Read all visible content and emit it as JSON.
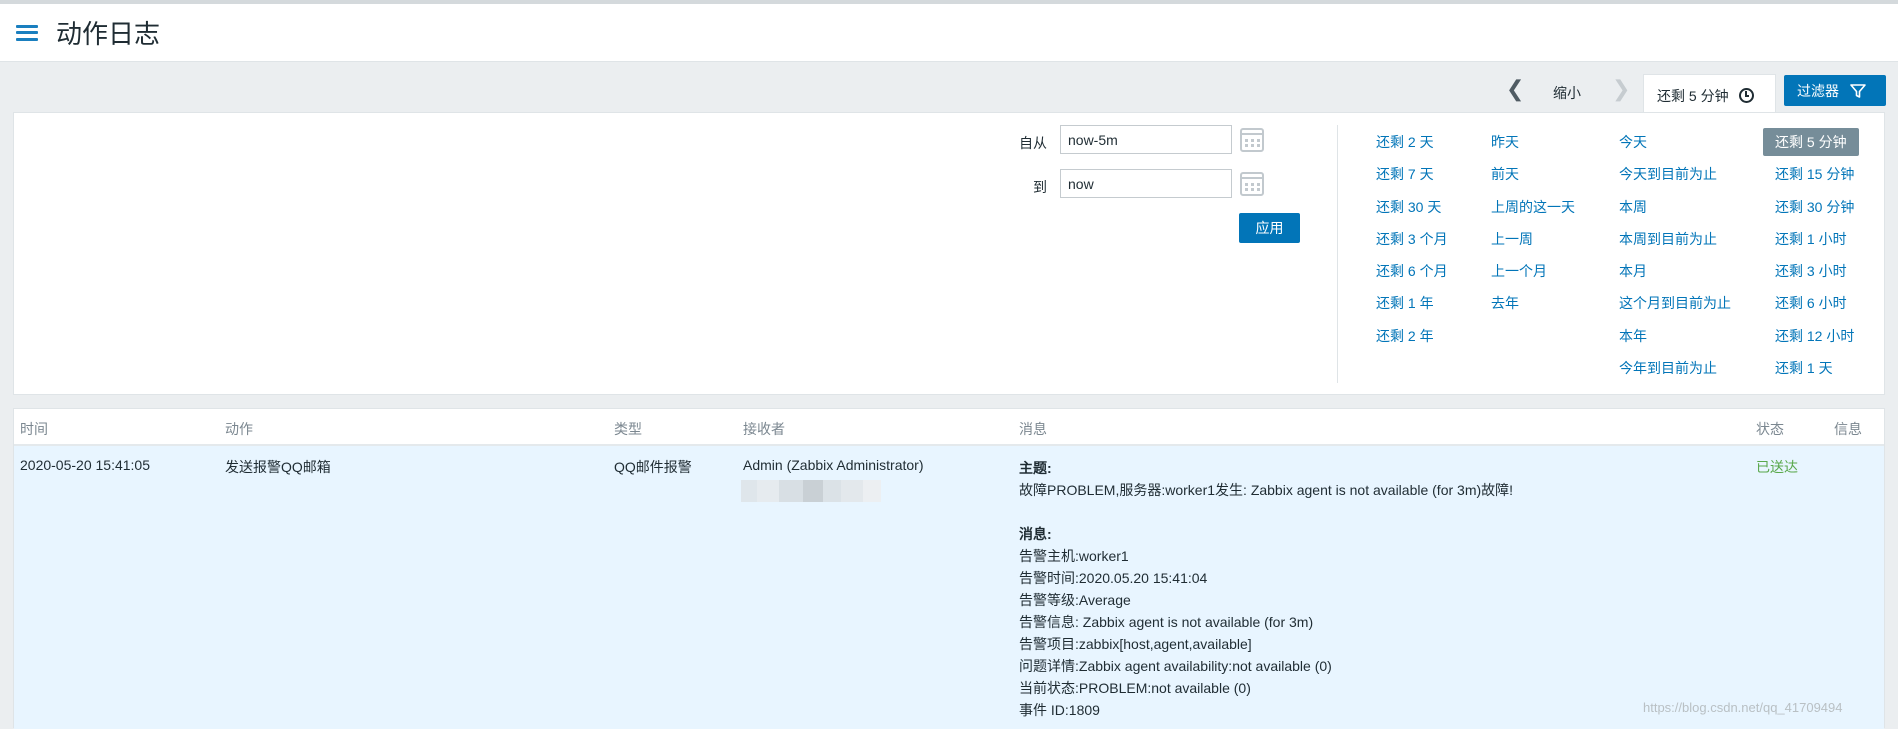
{
  "header": {
    "title": "动作日志"
  },
  "time_tabs": {
    "zoom_label": "缩小",
    "current_range": "还剩 5 分钟",
    "filter_button": "过滤器"
  },
  "filter": {
    "from_label": "自从",
    "from_value": "now-5m",
    "to_label": "到",
    "to_value": "now",
    "apply_label": "应用",
    "quick_ranges": {
      "col1": [
        "还剩 2 天",
        "还剩 7 天",
        "还剩 30 天",
        "还剩 3 个月",
        "还剩 6 个月",
        "还剩 1 年",
        "还剩 2 年"
      ],
      "col2": [
        "昨天",
        "前天",
        "上周的这一天",
        "上一周",
        "上一个月",
        "去年"
      ],
      "col3": [
        "今天",
        "今天到目前为止",
        "本周",
        "本周到目前为止",
        "本月",
        "这个月到目前为止",
        "本年",
        "今年到目前为止"
      ],
      "col4": [
        "还剩 5 分钟",
        "还剩 15 分钟",
        "还剩 30 分钟",
        "还剩 1 小时",
        "还剩 3 小时",
        "还剩 6 小时",
        "还剩 12 小时",
        "还剩 1 天"
      ],
      "selected": "还剩 5 分钟"
    }
  },
  "table": {
    "headers": {
      "time": "时间",
      "action": "动作",
      "type": "类型",
      "recipient": "接收者",
      "message": "消息",
      "status": "状态",
      "info": "信息"
    },
    "rows": [
      {
        "time": "2020-05-20 15:41:05",
        "action": "发送报警QQ邮箱",
        "type": "QQ邮件报警",
        "recipient": "Admin (Zabbix Administrator)",
        "subject_label": "主题:",
        "subject": "故障PROBLEM,服务器:worker1发生: Zabbix agent is not available (for 3m)故障!",
        "message_label": "消息:",
        "message_lines": [
          "告警主机:worker1",
          "告警时间:2020.05.20 15:41:04",
          "告警等级:Average",
          "告警信息: Zabbix agent is not available (for 3m)",
          "告警项目:zabbix[host,agent,available]",
          "问题详情:Zabbix agent availability:not available (0)",
          "当前状态:PROBLEM:not available (0)",
          "事件 ID:1809"
        ],
        "status": "已送达"
      }
    ]
  },
  "watermark": "https://blog.csdn.net/qq_41709494"
}
